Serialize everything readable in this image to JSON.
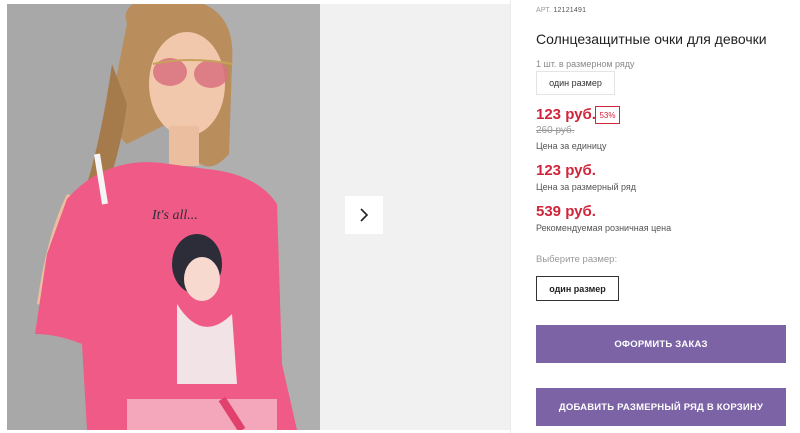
{
  "product": {
    "art_label": "АРТ.",
    "art_value": "12121491",
    "title": "Солнцезащитные очки для девочки",
    "row_note": "1 шт. в размерном ряду",
    "row_size": "один размер"
  },
  "pricing": {
    "unit_price": "123 руб.",
    "discount": "53%",
    "old_price": "260 руб.",
    "unit_caption": "Цена за единицу",
    "row_price": "123 руб.",
    "row_caption": "Цена за размерный ряд",
    "rrp": "539 руб.",
    "rrp_caption": "Рекомендуемая розничная цена"
  },
  "size_picker": {
    "label": "Выберите размер:",
    "option": "один размер"
  },
  "actions": {
    "order": "ОФОРМИТЬ ЗАКАЗ",
    "add_to_cart": "ДОБАВИТЬ РАЗМЕРНЫЙ РЯД В КОРЗИНУ"
  },
  "gallery": {
    "next_icon": "chevron-right-icon"
  },
  "colors": {
    "accent_price": "#d0253a",
    "button": "#7b63a6"
  }
}
